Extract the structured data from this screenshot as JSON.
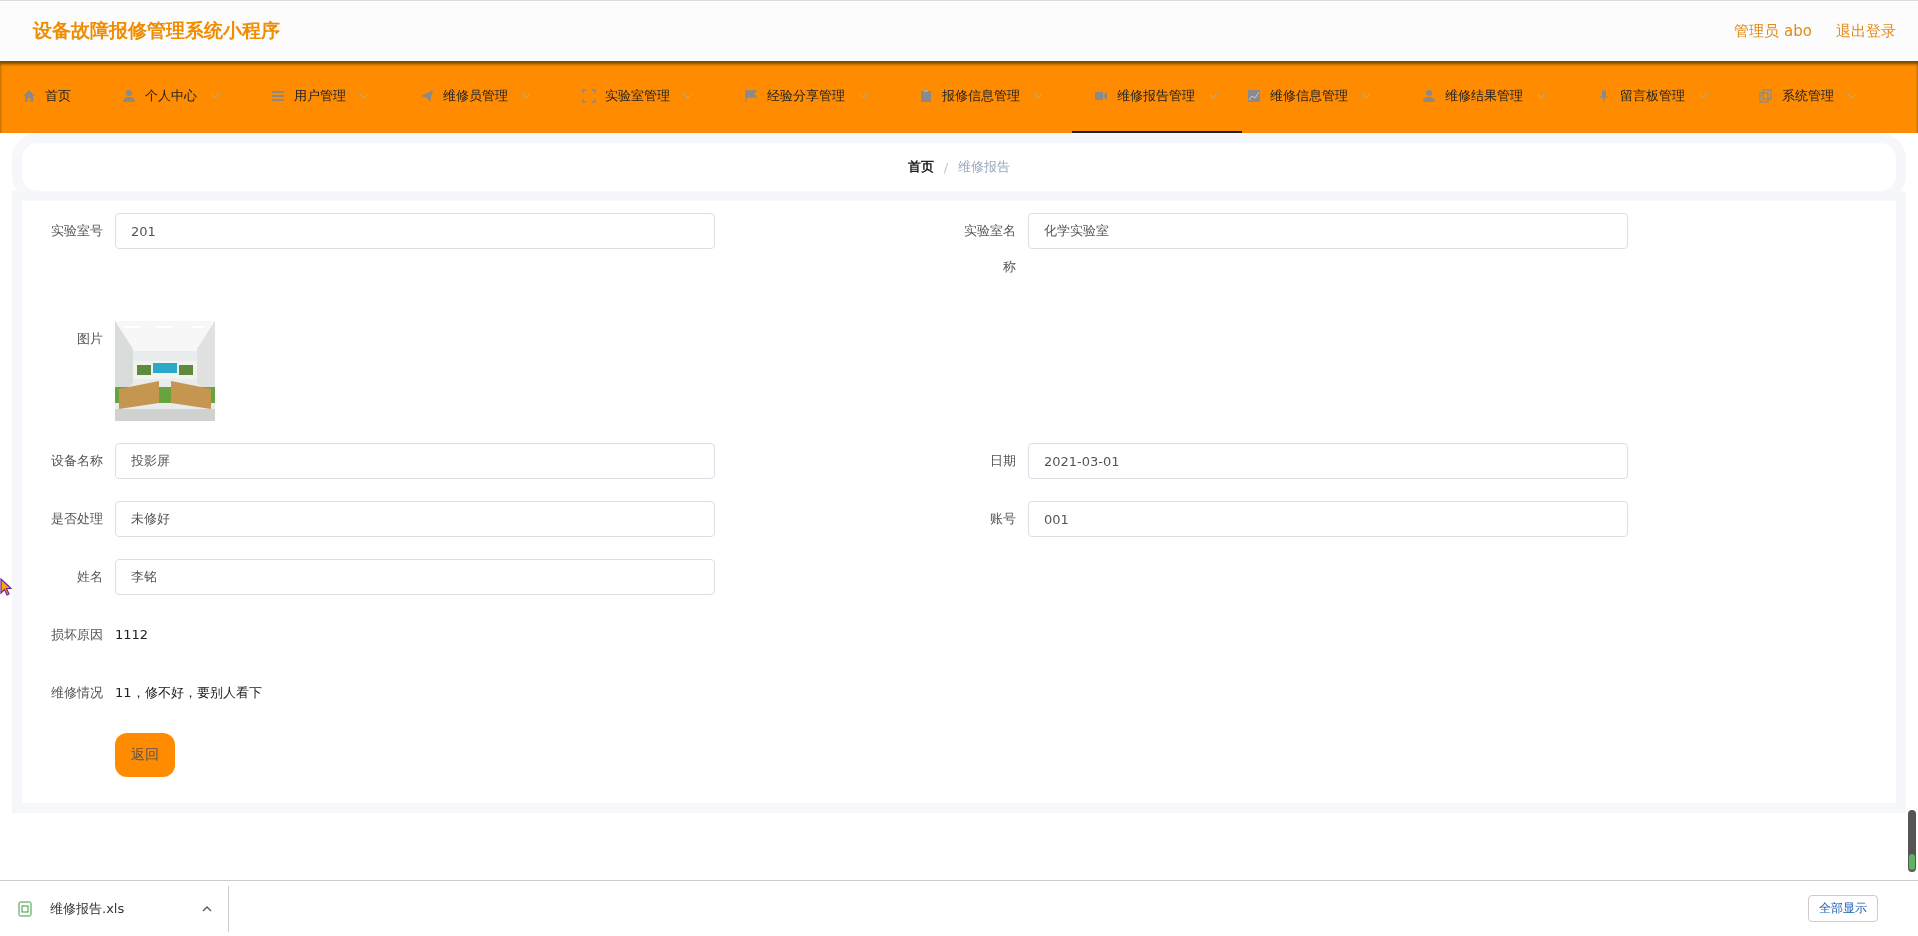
{
  "header": {
    "title": "设备故障报修管理系统小程序",
    "user": "管理员 abo",
    "logout": "退出登录"
  },
  "nav": [
    {
      "label": "首页",
      "has_menu": false,
      "selected": false
    },
    {
      "label": "个人中心",
      "has_menu": true,
      "selected": false
    },
    {
      "label": "用户管理",
      "has_menu": true,
      "selected": false
    },
    {
      "label": "维修员管理",
      "has_menu": true,
      "selected": false
    },
    {
      "label": "实验室管理",
      "has_menu": true,
      "selected": false
    },
    {
      "label": "经验分享管理",
      "has_menu": true,
      "selected": false
    },
    {
      "label": "报修信息管理",
      "has_menu": true,
      "selected": false
    },
    {
      "label": "维修报告管理",
      "has_menu": true,
      "selected": true
    },
    {
      "label": "维修信息管理",
      "has_menu": true,
      "selected": false
    },
    {
      "label": "维修结果管理",
      "has_menu": true,
      "selected": false
    },
    {
      "label": "留言板管理",
      "has_menu": true,
      "selected": false
    },
    {
      "label": "系统管理",
      "has_menu": true,
      "selected": false
    }
  ],
  "breadcrumb": [
    "首页",
    "维修报告"
  ],
  "breadcrumb_separator": "/",
  "form_rows": [
    [
      {
        "kind": "input",
        "label": "实验室号",
        "value": "201"
      },
      {
        "kind": "input",
        "label": "实验室名称",
        "value": "化学实验室"
      }
    ],
    [
      {
        "label": "图片"
      }
    ],
    [
      {
        "kind": "input",
        "label": "设备名称",
        "value": "投影屏"
      },
      {
        "kind": "input",
        "label": "日期",
        "value": "2021-03-01"
      }
    ],
    [
      {
        "kind": "input",
        "label": "是否处理",
        "value": "未修好"
      },
      {
        "kind": "input",
        "label": "账号",
        "value": "001"
      }
    ],
    [
      {
        "kind": "input",
        "label": "姓名",
        "value": "李铭"
      }
    ],
    [
      {
        "kind": "text",
        "label": "损坏原因",
        "value": "1112"
      }
    ],
    [
      {
        "kind": "text",
        "label": "维修情况",
        "value": "11，修不好，要别人看下"
      }
    ]
  ],
  "back_button": "返回",
  "download_bar": {
    "filename": "维修报告.xls",
    "show_all": "全部显示"
  }
}
